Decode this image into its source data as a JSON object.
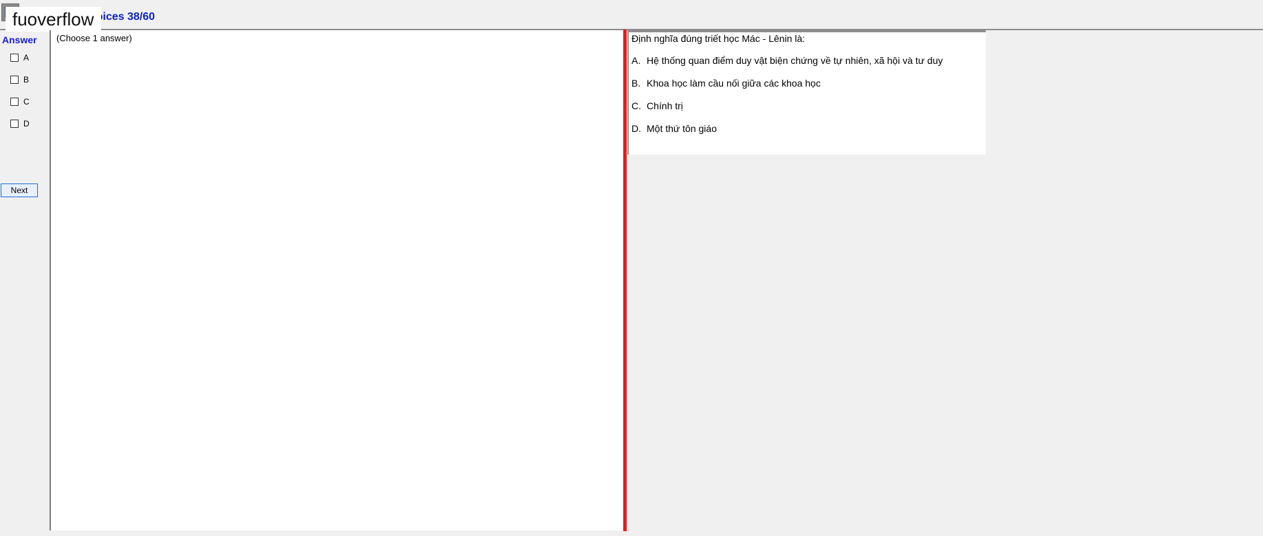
{
  "header": {
    "title": "hoices 38/60",
    "watermark": "fuoverflow",
    "icon": "app-icon"
  },
  "answer": {
    "heading": "Answer",
    "choices": [
      {
        "label": "A",
        "checked": false
      },
      {
        "label": "B",
        "checked": false
      },
      {
        "label": "C",
        "checked": false
      },
      {
        "label": "D",
        "checked": false
      }
    ],
    "next_label": "Next"
  },
  "left_panel": {
    "instruction": "(Choose 1 answer)"
  },
  "question": {
    "text": "Định nghĩa đúng triết học Mác - Lênin là:",
    "options": [
      {
        "letter": "A.",
        "text": "Hệ thống quan điểm duy vật biện chứng về tự nhiên, xã hội và tư duy"
      },
      {
        "letter": "B.",
        "text": "Khoa học làm cầu nối giữa các khoa học"
      },
      {
        "letter": "C.",
        "text": "Chính trị"
      },
      {
        "letter": "D.",
        "text": "Một thứ tôn giáo"
      }
    ]
  },
  "colors": {
    "header_title": "#0c21c6",
    "answer_heading": "#1620d8",
    "divider": "#e41d1d",
    "next_border": "#1e6fd0"
  }
}
